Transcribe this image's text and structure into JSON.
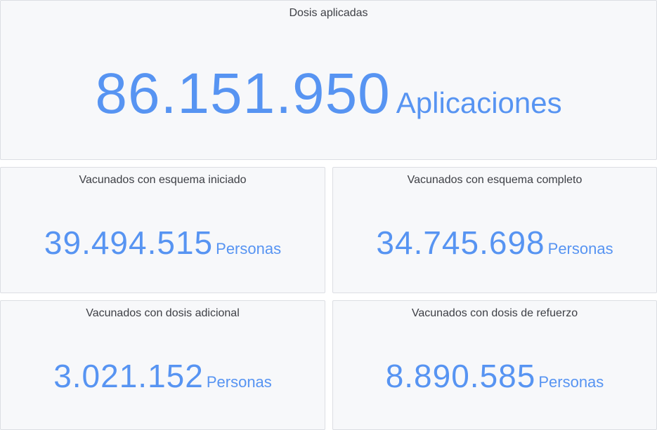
{
  "panels": {
    "total": {
      "title": "Dosis aplicadas",
      "value": "86.151.950",
      "unit": "Aplicaciones"
    },
    "iniciado": {
      "title": "Vacunados con esquema iniciado",
      "value": "39.494.515",
      "unit": "Personas"
    },
    "completo": {
      "title": "Vacunados con esquema completo",
      "value": "34.745.698",
      "unit": "Personas"
    },
    "adicional": {
      "title": "Vacunados con dosis adicional",
      "value": "3.021.152",
      "unit": "Personas"
    },
    "refuerzo": {
      "title": "Vacunados con dosis de refuerzo",
      "value": "8.890.585",
      "unit": "Personas"
    }
  },
  "colors": {
    "value": "#5794f2",
    "title": "#3d3f45",
    "panel_bg": "#f7f8fa",
    "panel_border": "#dcdee3"
  }
}
